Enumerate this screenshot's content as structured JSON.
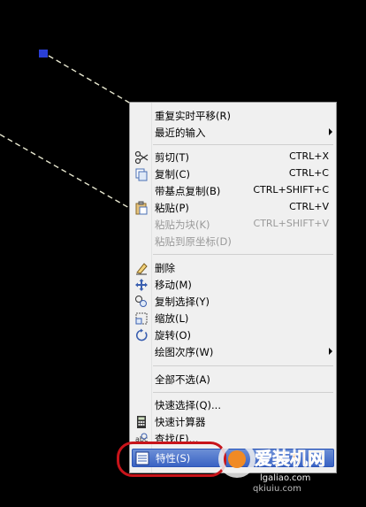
{
  "menu": {
    "items": [
      {
        "label": "重复实时平移(R)",
        "shortcut": "",
        "icon": "",
        "disabled": false,
        "submenu": false
      },
      {
        "label": "最近的输入",
        "shortcut": "",
        "icon": "",
        "disabled": false,
        "submenu": true
      },
      {
        "label": "剪切(T)",
        "shortcut": "CTRL+X",
        "icon": "scissors-icon",
        "disabled": false,
        "submenu": false
      },
      {
        "label": "复制(C)",
        "shortcut": "CTRL+C",
        "icon": "copy-icon",
        "disabled": false,
        "submenu": false
      },
      {
        "label": "带基点复制(B)",
        "shortcut": "CTRL+SHIFT+C",
        "icon": "",
        "disabled": false,
        "submenu": false
      },
      {
        "label": "粘贴(P)",
        "shortcut": "CTRL+V",
        "icon": "paste-icon",
        "disabled": false,
        "submenu": false
      },
      {
        "label": "粘贴为块(K)",
        "shortcut": "CTRL+SHIFT+V",
        "icon": "",
        "disabled": true,
        "submenu": false
      },
      {
        "label": "粘贴到原坐标(D)",
        "shortcut": "",
        "icon": "",
        "disabled": true,
        "submenu": false
      },
      {
        "label": "删除",
        "shortcut": "",
        "icon": "eraser-icon",
        "disabled": false,
        "submenu": false
      },
      {
        "label": "移动(M)",
        "shortcut": "",
        "icon": "move-icon",
        "disabled": false,
        "submenu": false
      },
      {
        "label": "复制选择(Y)",
        "shortcut": "",
        "icon": "copy-selection-icon",
        "disabled": false,
        "submenu": false
      },
      {
        "label": "缩放(L)",
        "shortcut": "",
        "icon": "scale-icon",
        "disabled": false,
        "submenu": false
      },
      {
        "label": "旋转(O)",
        "shortcut": "",
        "icon": "rotate-icon",
        "disabled": false,
        "submenu": false
      },
      {
        "label": "绘图次序(W)",
        "shortcut": "",
        "icon": "",
        "disabled": false,
        "submenu": true
      },
      {
        "label": "全部不选(A)",
        "shortcut": "",
        "icon": "",
        "disabled": false,
        "submenu": false
      },
      {
        "label": "快速选择(Q)...",
        "shortcut": "",
        "icon": "",
        "disabled": false,
        "submenu": false
      },
      {
        "label": "快速计算器",
        "shortcut": "",
        "icon": "calculator-icon",
        "disabled": false,
        "submenu": false
      },
      {
        "label": "查找(F)...",
        "shortcut": "",
        "icon": "find-icon",
        "disabled": false,
        "submenu": false
      },
      {
        "label": "特性(S)",
        "shortcut": "",
        "icon": "properties-icon",
        "disabled": false,
        "submenu": false
      }
    ]
  },
  "watermark": {
    "text": "爱装机网",
    "url": "lgaliao.com",
    "sub": "qkiuiu.com"
  },
  "colors": {
    "highlight": "#c8141a",
    "grip": "#2a3fd6",
    "dash": "#e8e8d0"
  }
}
